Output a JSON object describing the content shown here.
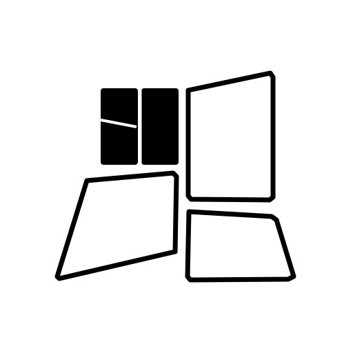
{
  "logo": {
    "icon": "window-panels-icon",
    "colors": {
      "foreground": "#000000",
      "background": "#ffffff"
    }
  }
}
